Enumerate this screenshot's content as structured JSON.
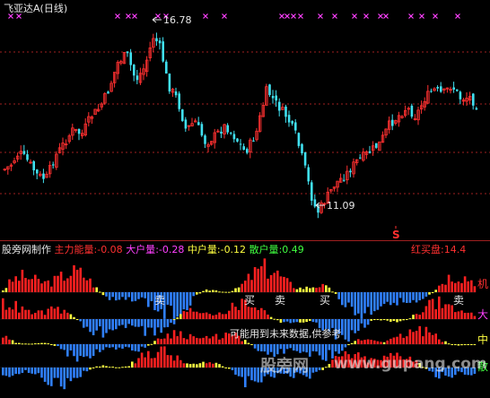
{
  "header": {
    "title": "飞亚达A",
    "period": "(日线)"
  },
  "price": {
    "high_label": "16.78",
    "low_label": "11.09",
    "marker": "S",
    "marker_color": "#ff3030"
  },
  "indicator": {
    "name": "股旁网制作",
    "items": [
      {
        "label": "主力能量",
        "value": "-0.08",
        "color": "#ff3030"
      },
      {
        "label": "大户量",
        "value": "-0.28",
        "color": "#ff40ff"
      },
      {
        "label": "中户量",
        "value": "-0.12",
        "color": "#ffff40"
      },
      {
        "label": "散户量",
        "value": "0.49",
        "color": "#40ff40"
      }
    ],
    "right_label": "红买盘",
    "right_value": "14.4"
  },
  "signals": [
    "卖",
    "买",
    "卖",
    "买",
    "卖"
  ],
  "row_labels": [
    {
      "text": "机",
      "color": "#ff3030"
    },
    {
      "text": "大",
      "color": "#ff40ff"
    },
    {
      "text": "中",
      "color": "#ffff40"
    },
    {
      "text": "散",
      "color": "#40ff40"
    }
  ],
  "disclaimer": "可能用到未来数据,供参考",
  "watermark": {
    "cn": "股旁网",
    "url": "www.gupang.com"
  },
  "colors": {
    "up": "#ff3030",
    "down": "#40e0f0",
    "blue": "#3080ff",
    "yellow": "#ffff40",
    "red": "#ff2020",
    "cross": "#ff40ff"
  }
}
